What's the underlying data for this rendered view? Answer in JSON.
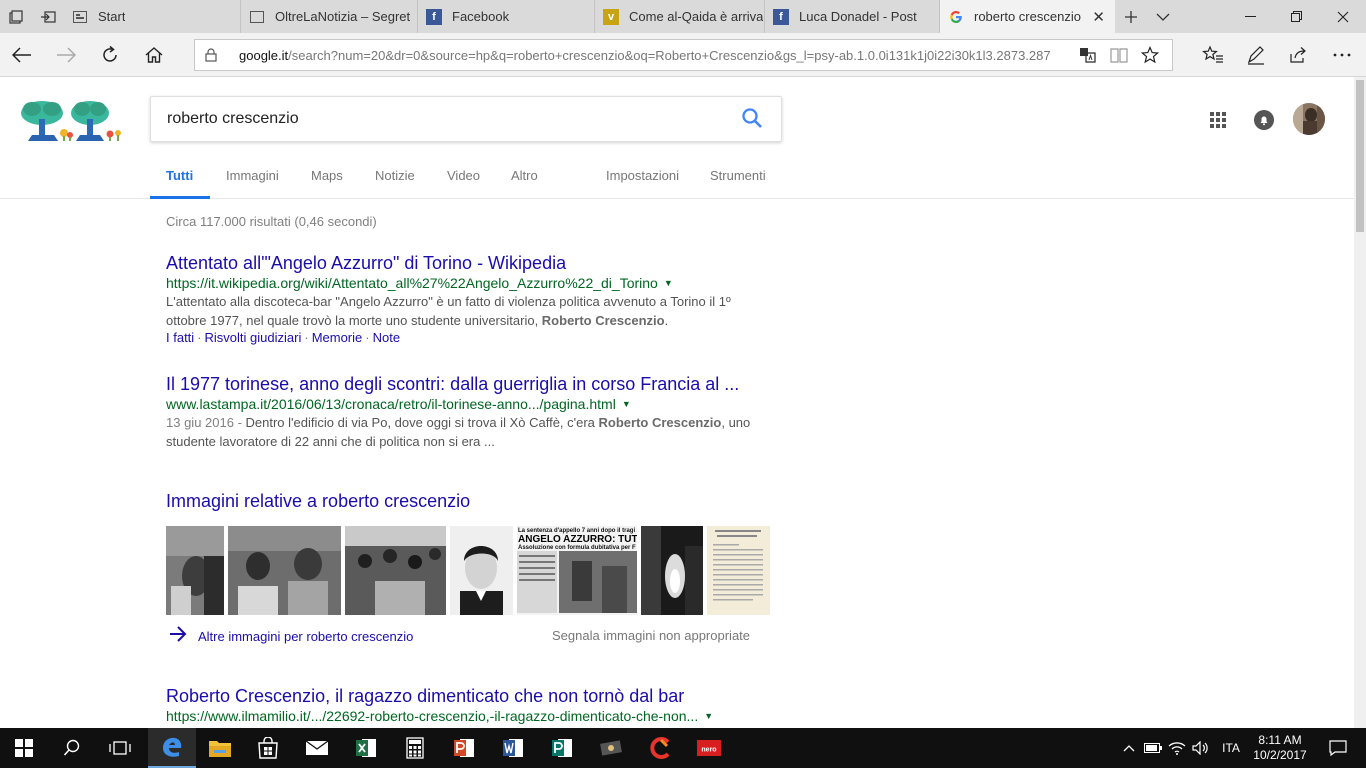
{
  "tabs": [
    {
      "label": "Start"
    },
    {
      "label": "OltreLaNotizia – Segret"
    },
    {
      "label": "Facebook"
    },
    {
      "label": "Come al-Qaida è arriva"
    },
    {
      "label": "Luca Donadel - Post"
    },
    {
      "label": "roberto crescenzio"
    }
  ],
  "address": {
    "host": "google.it",
    "path": "/search?num=20&dr=0&source=hp&q=roberto+crescenzio&oq=Roberto+Crescenzio&gs_l=psy-ab.1.0.0i131k1j0i22i30k1l3.2873.287"
  },
  "search": {
    "query": "roberto crescenzio"
  },
  "gtabs": [
    "Tutti",
    "Immagini",
    "Maps",
    "Notizie",
    "Video",
    "Altro",
    "Impostazioni",
    "Strumenti"
  ],
  "stats": "Circa 117.000 risultati (0,46 secondi)",
  "results": [
    {
      "title": "Attentato all'\"Angelo Azzurro\" di Torino - Wikipedia",
      "url": "https://it.wikipedia.org/wiki/Attentato_all%27%22Angelo_Azzurro%22_di_Torino",
      "snippet_a": "L'attentato alla discoteca-bar \"Angelo Azzurro\" è un fatto di violenza politica avvenuto a Torino il 1º ottobre 1977, nel quale trovò la morte uno studente universitario, ",
      "snippet_bold": "Roberto Crescenzio",
      "snippet_b": ".",
      "sitelinks": [
        "I fatti",
        "Risvolti giudiziari",
        "Memorie",
        "Note"
      ]
    },
    {
      "title": "Il 1977 torinese, anno degli scontri: dalla guerriglia in corso Francia al ...",
      "url": "www.lastampa.it/2016/06/13/cronaca/retro/il-torinese-anno.../pagina.html",
      "date": "13 giu 2016 - ",
      "snippet_a": "Dentro l'edificio di via Po, dove oggi si trova il Xò Caffè, c'era ",
      "snippet_bold": "Roberto Crescenzio",
      "snippet_b": ", uno studente lavoratore di 22 anni che di politica non si era ..."
    },
    {
      "title": "Roberto Crescenzio, il ragazzo dimenticato che non tornò dal bar",
      "url": "https://www.ilmamilio.it/.../22692-roberto-crescenzio,-il-ragazzo-dimenticato-che-non..."
    }
  ],
  "images": {
    "heading": "Immagini relative a roberto crescenzio",
    "more": "Altre immagini per roberto crescenzio",
    "report": "Segnala immagini non appropriate",
    "thumb4_headline": "ANGELO AZZURRO: TUTT",
    "thumb4_top": "La sentenza d'appello 7 anni dopo il tragi",
    "thumb4_sub": "Assoluzione con formula dubitativa per F"
  },
  "clock": {
    "time": "8:11 AM",
    "date": "10/2/2017"
  },
  "lang": "ITA",
  "colors": {
    "link": "#1a0dab",
    "url": "#006621",
    "accent": "#1a73e8"
  }
}
